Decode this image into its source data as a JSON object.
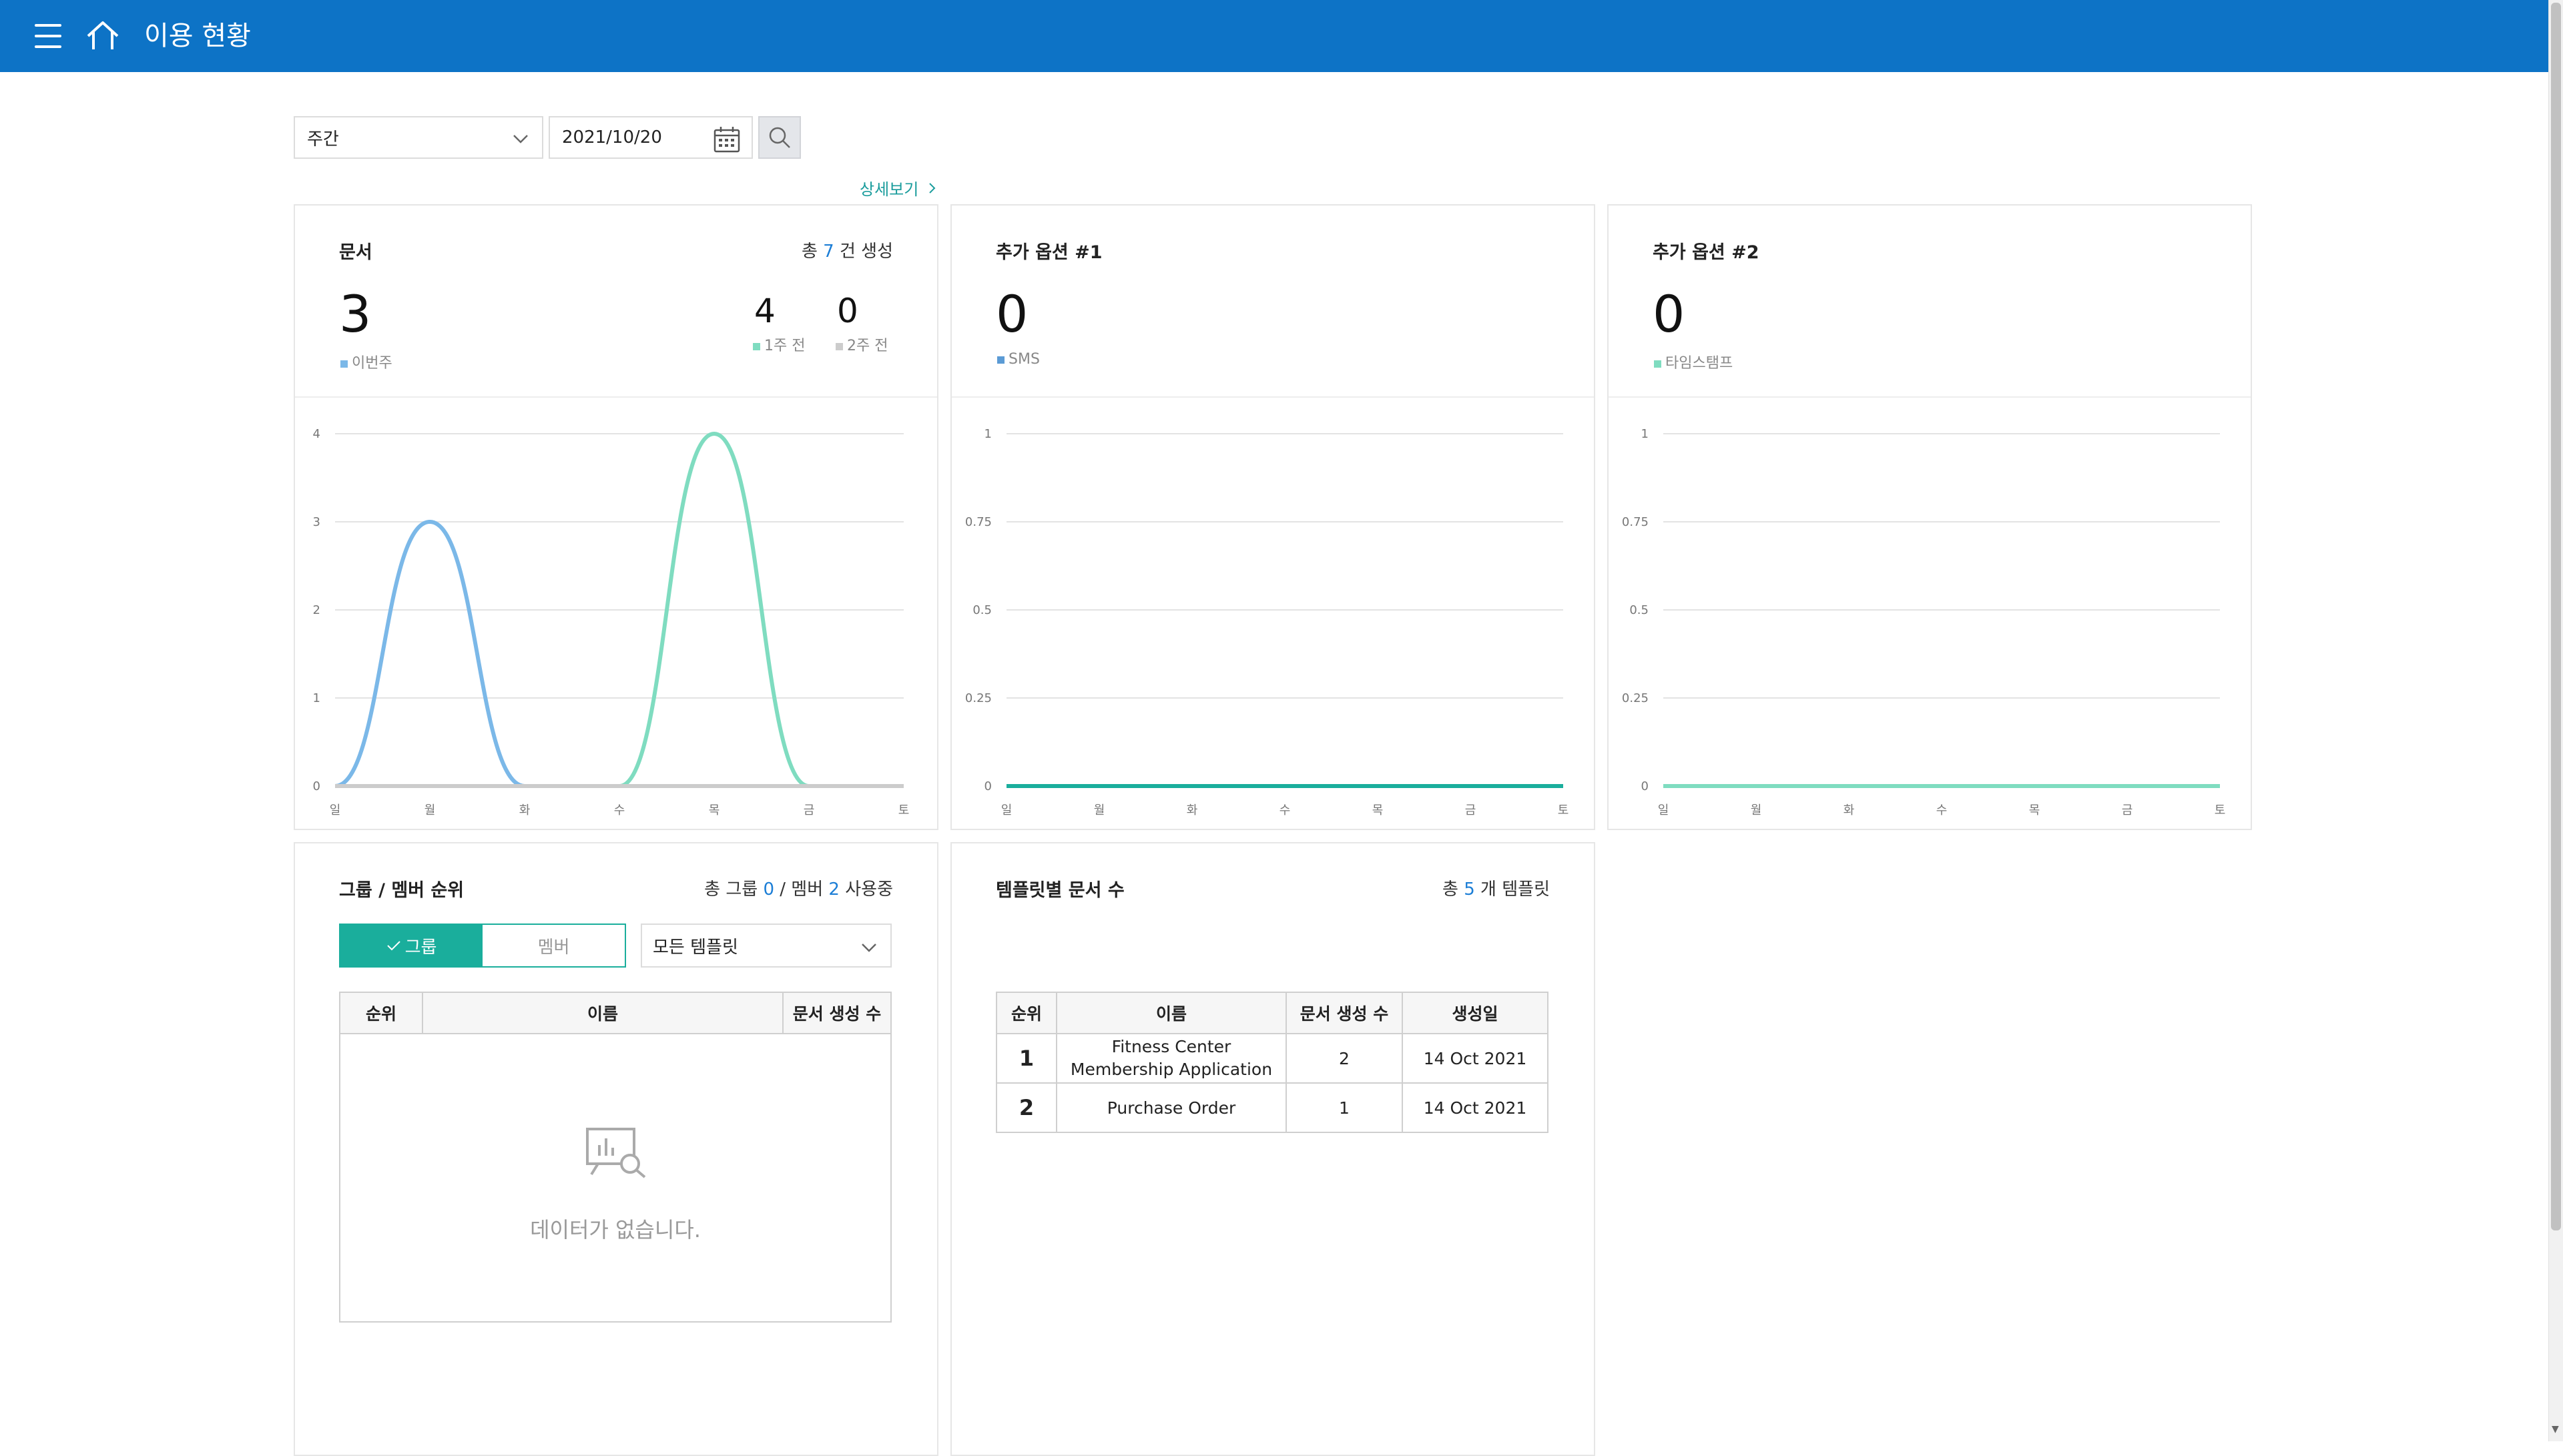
{
  "header": {
    "title": "이용 현황"
  },
  "filters": {
    "period": "주간",
    "date": "2021/10/20"
  },
  "detail_link": "상세보기",
  "documents_card": {
    "title": "문서",
    "summary_prefix": "총",
    "summary_count": "7",
    "summary_suffix": "건 생성",
    "this_week_value": "3",
    "this_week_label": "이번주",
    "one_week_ago_value": "4",
    "one_week_ago_label": "1주 전",
    "two_weeks_ago_value": "0",
    "two_weeks_ago_label": "2주 전"
  },
  "option1_card": {
    "title": "추가 옵션 #1",
    "value": "0",
    "label": "SMS"
  },
  "option2_card": {
    "title": "추가 옵션 #2",
    "value": "0",
    "label": "타임스탬프"
  },
  "colors": {
    "this_week": "#7bb8e8",
    "one_week_ago": "#7fdcc0",
    "two_weeks_ago": "#cccccc",
    "accent": "#1aae9c",
    "header": "#0d73c6"
  },
  "chart_data": [
    {
      "type": "line",
      "categories": [
        "일",
        "월",
        "화",
        "수",
        "목",
        "금",
        "토"
      ],
      "series": [
        {
          "name": "이번주",
          "values": [
            0,
            3,
            0,
            0,
            0,
            0,
            0
          ]
        },
        {
          "name": "1주 전",
          "values": [
            0,
            0,
            0,
            0,
            4,
            0,
            0
          ]
        },
        {
          "name": "2주 전",
          "values": [
            0,
            0,
            0,
            0,
            0,
            0,
            0
          ]
        }
      ],
      "yticks": [
        "0",
        "1",
        "2",
        "3",
        "4"
      ],
      "ylim": [
        0,
        4
      ]
    },
    {
      "type": "line",
      "categories": [
        "일",
        "월",
        "화",
        "수",
        "목",
        "금",
        "토"
      ],
      "series": [
        {
          "name": "SMS",
          "values": [
            0,
            0,
            0,
            0,
            0,
            0,
            0
          ]
        }
      ],
      "yticks": [
        "0",
        "0.25",
        "0.5",
        "0.75",
        "1"
      ],
      "ylim": [
        0,
        1
      ]
    },
    {
      "type": "line",
      "categories": [
        "일",
        "월",
        "화",
        "수",
        "목",
        "금",
        "토"
      ],
      "series": [
        {
          "name": "타임스탬프",
          "values": [
            0,
            0,
            0,
            0,
            0,
            0,
            0
          ]
        }
      ],
      "yticks": [
        "0",
        "0.25",
        "0.5",
        "0.75",
        "1"
      ],
      "ylim": [
        0,
        1
      ]
    }
  ],
  "ranking_card": {
    "title": "그룹 / 멤버 순위",
    "summary_prefix": "총 그룹",
    "group_count": "0",
    "summary_mid": "/ 멤버",
    "member_count": "2",
    "summary_suffix": "사용중",
    "toggle_group": "그룹",
    "toggle_member": "멤버",
    "template_select": "모든 템플릿",
    "columns": [
      "순위",
      "이름",
      "문서 생성 수"
    ],
    "empty_message": "데이터가 없습니다."
  },
  "template_card": {
    "title": "템플릿별 문서 수",
    "summary_prefix": "총",
    "summary_count": "5",
    "summary_suffix": "개 템플릿",
    "columns": [
      "순위",
      "이름",
      "문서 생성 수",
      "생성일"
    ],
    "rows": [
      {
        "rank": "1",
        "name_line1": "Fitness Center",
        "name_line2": "Membership Application",
        "count": "2",
        "date": "14 Oct 2021"
      },
      {
        "rank": "2",
        "name_line1": "Purchase Order",
        "name_line2": "",
        "count": "1",
        "date": "14 Oct 2021"
      }
    ]
  }
}
